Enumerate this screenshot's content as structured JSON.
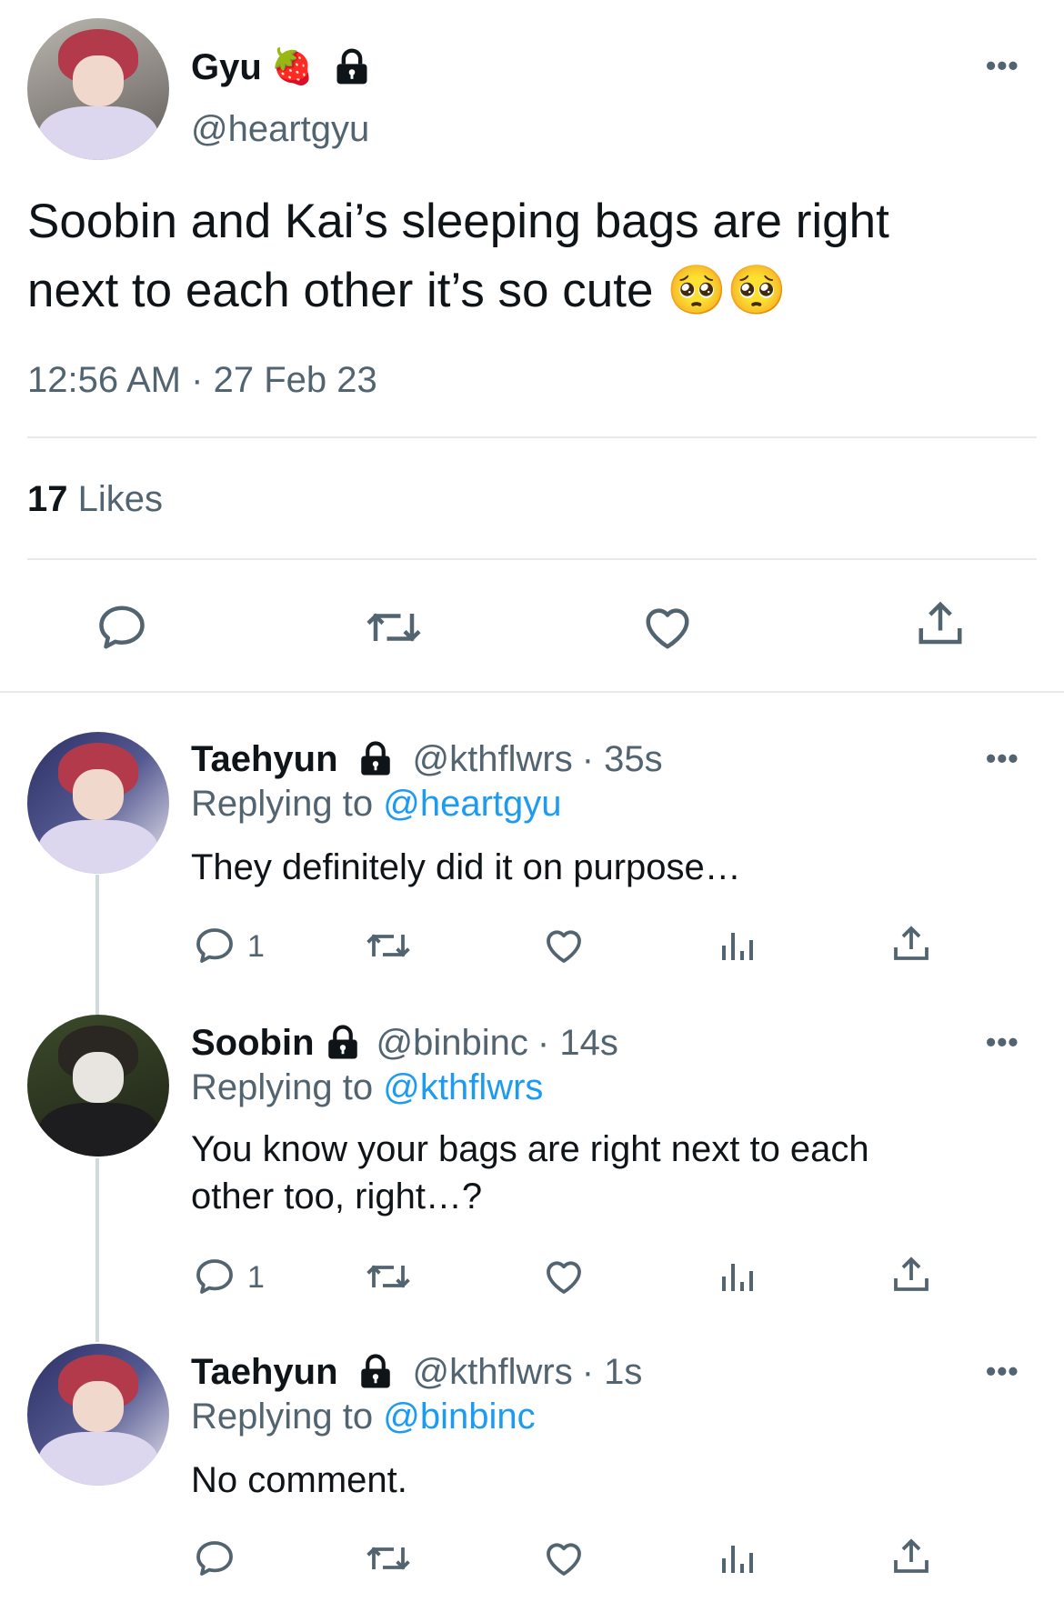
{
  "main_tweet": {
    "author_name": "Gyu",
    "name_emoji": "🍓",
    "handle": "@heartgyu",
    "text_line1": "Soobin and Kai’s sleeping bags are right",
    "text_line2": "next to each other it’s so cute 🥺🥺",
    "time": "12:56 AM",
    "date_sep": "·",
    "date": "27 Feb 23",
    "likes_count": "17",
    "likes_label": "Likes"
  },
  "replies": [
    {
      "author_name": "Taehyun",
      "handle": "@kthflwrs",
      "time": "· 35s",
      "replying_label": "Replying to ",
      "replying_to": "@heartgyu",
      "text_line1": "They definitely did it on purpose…",
      "text_line2": "",
      "reply_count": "1"
    },
    {
      "author_name": "Soobin",
      "handle": "@binbinc",
      "time": "· 14s",
      "replying_label": "Replying to ",
      "replying_to": "@kthflwrs",
      "text_line1": "You know your bags are right next to each",
      "text_line2": "other too, right…?",
      "reply_count": "1"
    },
    {
      "author_name": "Taehyun",
      "handle": "@kthflwrs",
      "time": "· 1s",
      "replying_label": "Replying to ",
      "replying_to": "@binbinc",
      "text_line1": "No comment.",
      "text_line2": "",
      "reply_count": ""
    }
  ],
  "more_label": "•••",
  "icons": [
    "avatar",
    "strawberry-emoji",
    "lock-icon",
    "more-icon",
    "reply-icon",
    "retweet-icon",
    "like-icon",
    "share-icon",
    "views-icon"
  ]
}
